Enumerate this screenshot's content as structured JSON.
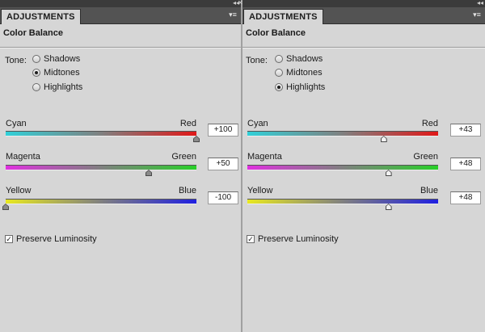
{
  "panels": [
    {
      "tab_label": "ADJUSTMENTS",
      "title": "Color Balance",
      "tone_label": "Tone:",
      "tones": [
        {
          "label": "Shadows",
          "selected": false
        },
        {
          "label": "Midtones",
          "selected": true
        },
        {
          "label": "Highlights",
          "selected": false
        }
      ],
      "sliders": [
        {
          "left": "Cyan",
          "right": "Red",
          "value": "+100",
          "number": 100
        },
        {
          "left": "Magenta",
          "right": "Green",
          "value": "+50",
          "number": 50
        },
        {
          "left": "Yellow",
          "right": "Blue",
          "value": "-100",
          "number": -100
        }
      ],
      "preserve": {
        "label": "Preserve Luminosity",
        "checked": true
      }
    },
    {
      "tab_label": "ADJUSTMENTS",
      "title": "Color Balance",
      "tone_label": "Tone:",
      "tones": [
        {
          "label": "Shadows",
          "selected": false
        },
        {
          "label": "Midtones",
          "selected": false
        },
        {
          "label": "Highlights",
          "selected": true
        }
      ],
      "sliders": [
        {
          "left": "Cyan",
          "right": "Red",
          "value": "+43",
          "number": 43
        },
        {
          "left": "Magenta",
          "right": "Green",
          "value": "+48",
          "number": 48
        },
        {
          "left": "Yellow",
          "right": "Blue",
          "value": "+48",
          "number": 48
        }
      ],
      "preserve": {
        "label": "Preserve Luminosity",
        "checked": true
      }
    }
  ],
  "window_controls": {
    "collapse_icon": "double-chevron-icon",
    "close_icon": "close-icon",
    "menu_icon": "panel-menu-icon"
  },
  "colors": {
    "cyan": "#30d0d8",
    "red": "#e01818",
    "magenta": "#e030e0",
    "green": "#28d028",
    "yellow": "#e8e820",
    "blue": "#2020e0"
  }
}
